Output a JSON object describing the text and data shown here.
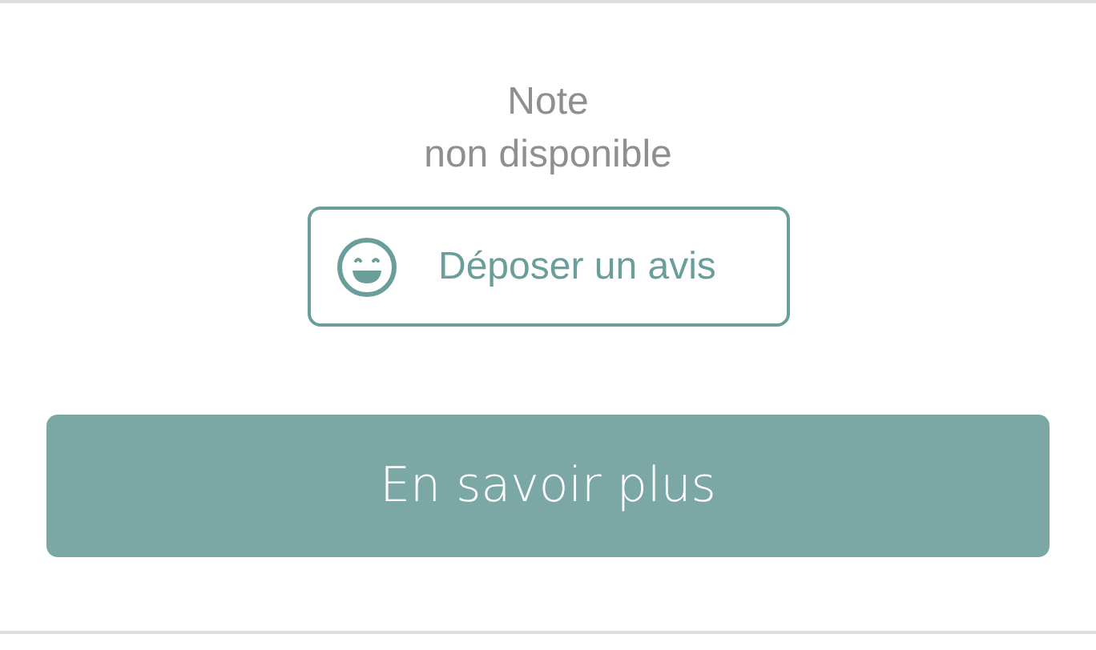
{
  "rating": {
    "lines": [
      "Note",
      "non disponible"
    ]
  },
  "review_button": {
    "label": "Déposer un avis"
  },
  "more_button": {
    "label": "En savoir plus"
  }
}
